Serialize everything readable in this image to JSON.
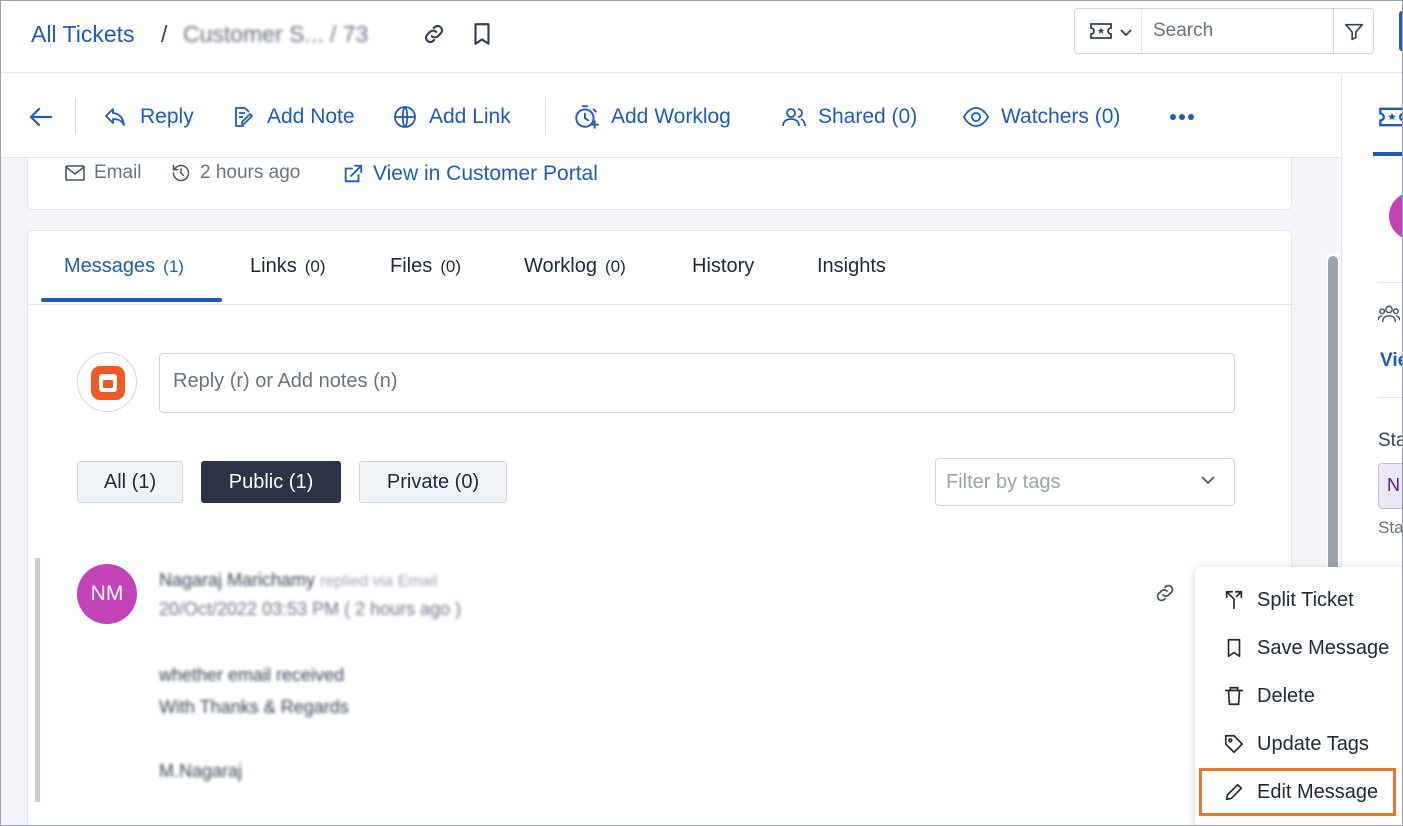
{
  "breadcrumb": {
    "root": "All Tickets",
    "separator": "/",
    "blurred": "Customer S...  /  73"
  },
  "search": {
    "placeholder": "Search"
  },
  "actions": {
    "reply": "Reply",
    "add_note": "Add Note",
    "add_link": "Add Link",
    "add_worklog": "Add Worklog",
    "shared": "Shared (0)",
    "watchers": "Watchers (0)"
  },
  "info": {
    "source": "Email",
    "time": "2 hours ago",
    "portal_link": "View in Customer Portal"
  },
  "tabs": [
    {
      "label": "Messages",
      "count": "(1)"
    },
    {
      "label": "Links",
      "count": "(0)"
    },
    {
      "label": "Files",
      "count": "(0)"
    },
    {
      "label": "Worklog",
      "count": "(0)"
    },
    {
      "label": "History",
      "count": ""
    },
    {
      "label": "Insights",
      "count": ""
    }
  ],
  "reply_box": {
    "placeholder": "Reply (r) or Add notes (n)"
  },
  "filters": {
    "all": "All (1)",
    "public": "Public (1)",
    "private": "Private (0)",
    "tags_placeholder": "Filter by tags"
  },
  "message": {
    "initials": "NM",
    "author": "Nagaraj Marichamy",
    "via": "replied via Email",
    "date": "20/Oct/2022 03:53 PM ( 2 hours ago )",
    "body_line1": "whether email received",
    "body_line2": "With Thanks & Regards",
    "signature": "M.Nagaraj"
  },
  "context_menu": {
    "split_ticket": "Split Ticket",
    "save_message": "Save Message",
    "delete": "Delete",
    "update_tags": "Update Tags",
    "edit_message": "Edit Message"
  },
  "right_panel": {
    "link_text": "Vie",
    "label1": "Sta",
    "badge": "N",
    "label2": "Sta"
  },
  "colors": {
    "accent": "#1f5bbf",
    "avatar": "#c243b8",
    "highlight": "#e8772e",
    "dark_chip": "#2b3444"
  }
}
